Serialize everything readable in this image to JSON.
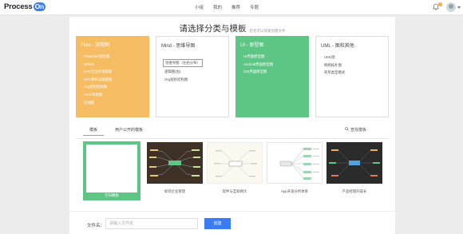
{
  "app": {
    "logo_text": "Process",
    "logo_badge": "On"
  },
  "nav": {
    "items": [
      "小组",
      "我的",
      "推荐",
      "专题"
    ]
  },
  "notifications": {
    "count": "1"
  },
  "dialog": {
    "title": "请选择分类与模板",
    "subtitle": "您也可以快速创建文件"
  },
  "categories": [
    {
      "title": "Flow - 流程图",
      "items": [
        "Flowchart流程图",
        "BPMN",
        "EVC企业价值链图",
        "EPC事件过程链图",
        "Org组织结构图",
        "Venn韦恩图",
        "红线图"
      ]
    },
    {
      "title": "Mind - 思维导图",
      "items": [
        "思维导图（左右分布）",
        "逻辑图(右)",
        "Org组织结构图"
      ],
      "selected": 0
    },
    {
      "title": "UI - 原型图",
      "items": [
        "UI界面原型图",
        "Android界面原型图",
        "iOS界面原型图"
      ]
    },
    {
      "title": "UML - 图和其他",
      "items": [
        "UML图",
        "网络拓扑图",
        "简单类型模式"
      ]
    }
  ],
  "tabs": {
    "templates": "模板",
    "user_public": "用户公开的模板",
    "search": "查找模板"
  },
  "templates": [
    "空白模板",
    "如何企业管理",
    "软件与互联网大",
    "App开发分析体系",
    "产品经理的成长"
  ],
  "footer": {
    "filename_label": "文件名：",
    "filename_placeholder": "请输入文件名",
    "create_label": "创建"
  },
  "colors": {
    "flow": "#f5bc63",
    "ui": "#5dc684",
    "accent": "#3b7cf0"
  }
}
